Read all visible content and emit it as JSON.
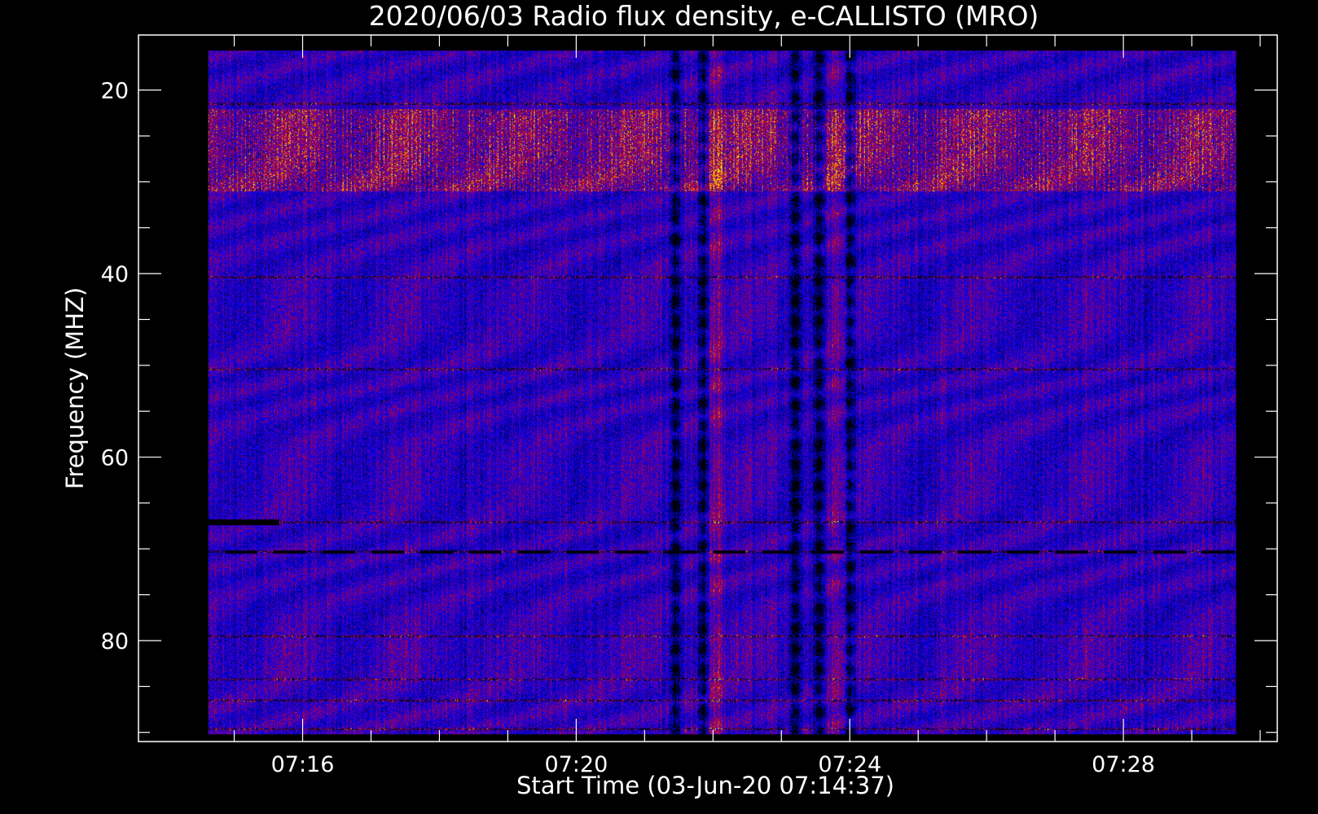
{
  "chart_data": {
    "type": "heatmap",
    "title": "2020/06/03  Radio flux density, e-CALLISTO (MRO)",
    "xlabel": "Start Time (03-Jun-20 07:14:37)",
    "ylabel": "Frequency (MHZ)",
    "x_unit": "minutes after 07:00 UT",
    "xlim": [
      13.6,
      30.25
    ],
    "ylim": [
      91.0,
      14.0
    ],
    "data_extent": {
      "x": [
        14.62,
        29.65
      ],
      "y": [
        15.7,
        90.2
      ]
    },
    "x_ticks": [
      {
        "value": 16,
        "label": "07:16"
      },
      {
        "value": 20,
        "label": "07:20"
      },
      {
        "value": 24,
        "label": "07:24"
      },
      {
        "value": 28,
        "label": "07:28"
      }
    ],
    "x_minor_ticks": [
      15,
      17,
      18,
      19,
      21,
      22,
      23,
      25,
      26,
      27,
      29,
      30
    ],
    "y_ticks": [
      {
        "value": 20,
        "label": "20"
      },
      {
        "value": 40,
        "label": "40"
      },
      {
        "value": 60,
        "label": "60"
      },
      {
        "value": 80,
        "label": "80"
      }
    ],
    "y_minor_ticks": [
      25,
      30,
      35,
      45,
      50,
      55,
      65,
      70,
      75,
      85,
      90
    ],
    "colormap": [
      "#000000",
      "#0000ff",
      "#ff0000",
      "#ffff00"
    ],
    "features": {
      "interference_band_mhz": [
        22,
        31
      ],
      "dark_stripes_minutes": [
        21.45,
        21.85,
        23.2,
        23.55,
        24.0
      ],
      "bright_columns_minutes": [
        22.0,
        22.1,
        23.75,
        23.9
      ],
      "horizontal_lines_mhz": [
        21.5,
        40.4,
        50.4,
        67.1,
        70.3,
        79.5,
        84.2,
        86.5,
        89.6
      ],
      "dashed_line_mhz": 70.3,
      "black_bar": {
        "x": [
          14.62,
          15.65
        ],
        "y_mhz": 67.1
      }
    }
  },
  "colors": {
    "background": "#000000",
    "foreground": "#ffffff"
  }
}
